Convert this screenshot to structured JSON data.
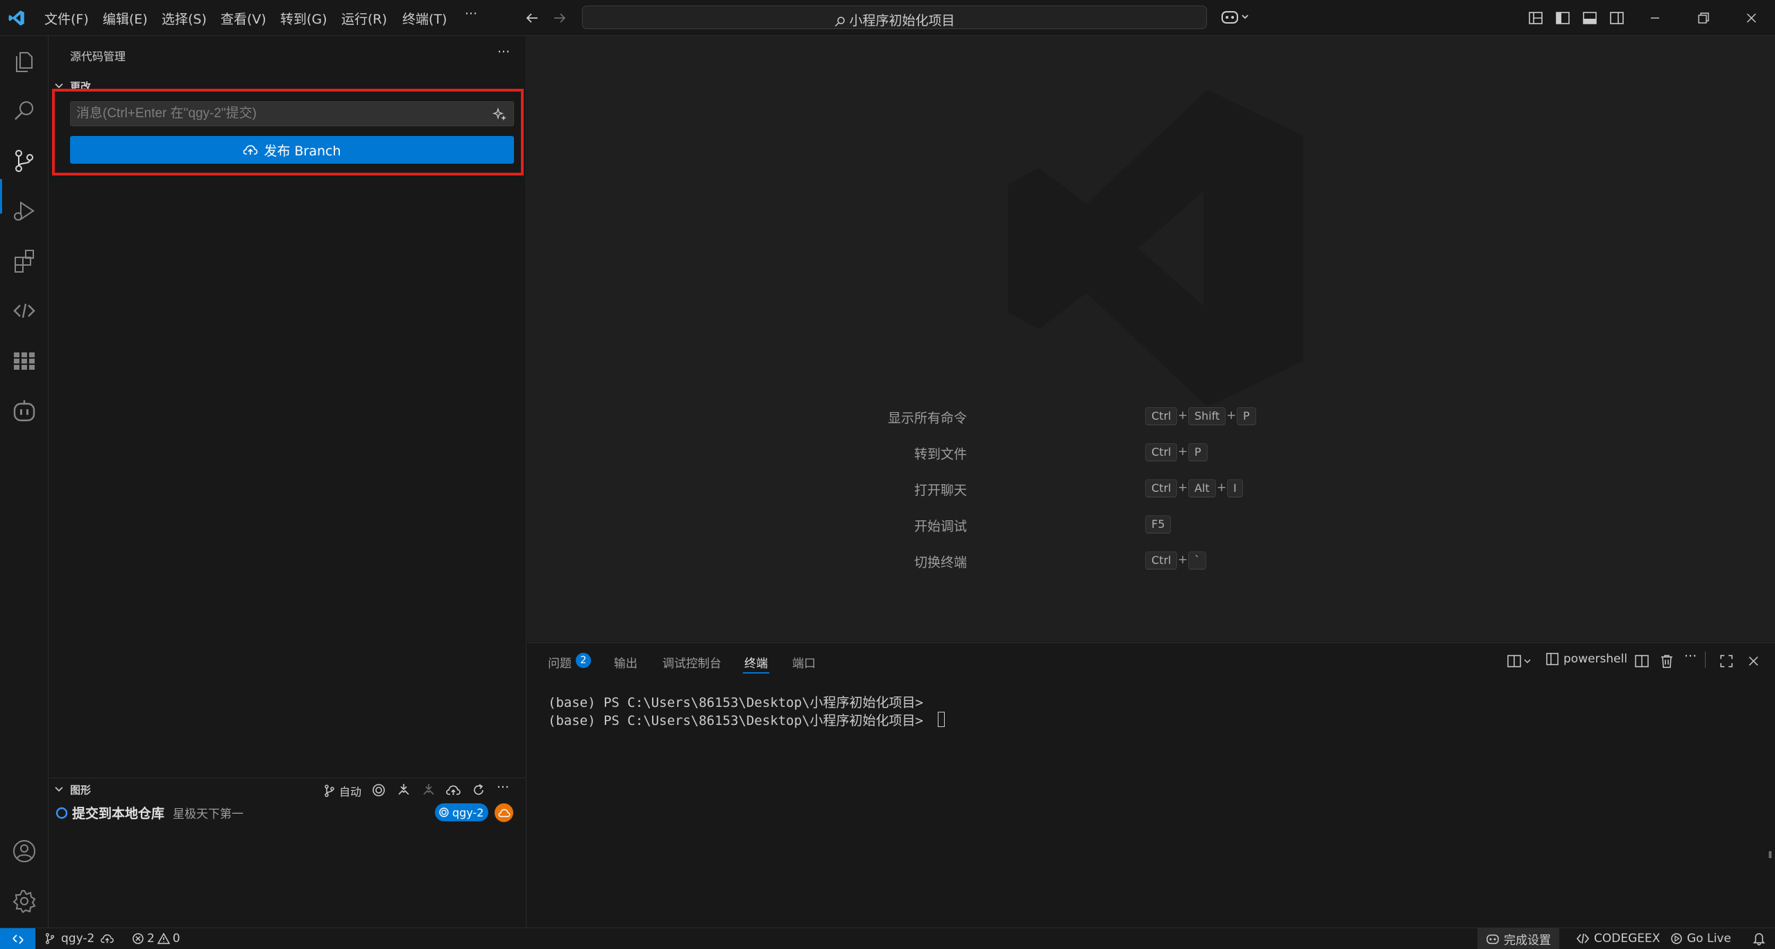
{
  "titlebar": {
    "menus": [
      "文件(F)",
      "编辑(E)",
      "选择(S)",
      "查看(V)",
      "转到(G)",
      "运行(R)",
      "终端(T)",
      "···"
    ],
    "search_text": "小程序初始化项目"
  },
  "sidebar": {
    "title": "源代码管理",
    "changes_section": "更改",
    "commit_placeholder": "消息(Ctrl+Enter 在\"qgy-2\"提交)",
    "publish_label": "发布 Branch",
    "graph_section": "图形",
    "graph_auto_label": "自动",
    "commit_title": "提交到本地仓库",
    "commit_author": "星极天下第一",
    "branch_badge": "qgy-2"
  },
  "editor": {
    "shortcuts": [
      {
        "label": "显示所有命令",
        "keys": [
          "Ctrl",
          "Shift",
          "P"
        ]
      },
      {
        "label": "转到文件",
        "keys": [
          "Ctrl",
          "P"
        ]
      },
      {
        "label": "打开聊天",
        "keys": [
          "Ctrl",
          "Alt",
          "I"
        ]
      },
      {
        "label": "开始调试",
        "keys": [
          "F5"
        ]
      },
      {
        "label": "切换终端",
        "keys": [
          "Ctrl",
          "`"
        ]
      }
    ]
  },
  "panel": {
    "tabs": [
      "问题",
      "输出",
      "调试控制台",
      "终端",
      "端口"
    ],
    "problems_count": "2",
    "active_tab": "终端",
    "shell_name": "powershell",
    "terminal_lines": [
      "(base) PS C:\\Users\\86153\\Desktop\\小程序初始化项目>",
      "(base) PS C:\\Users\\86153\\Desktop\\小程序初始化项目>"
    ]
  },
  "statusbar": {
    "branch": "qgy-2",
    "errors": "2",
    "warnings": "0",
    "setup_label": "完成设置",
    "codegeex_label": "CODEGEEX",
    "golive_label": "Go Live"
  },
  "colors": {
    "accent": "#0078d4",
    "highlight": "#e3201a",
    "badge_orange": "#e8740c"
  }
}
